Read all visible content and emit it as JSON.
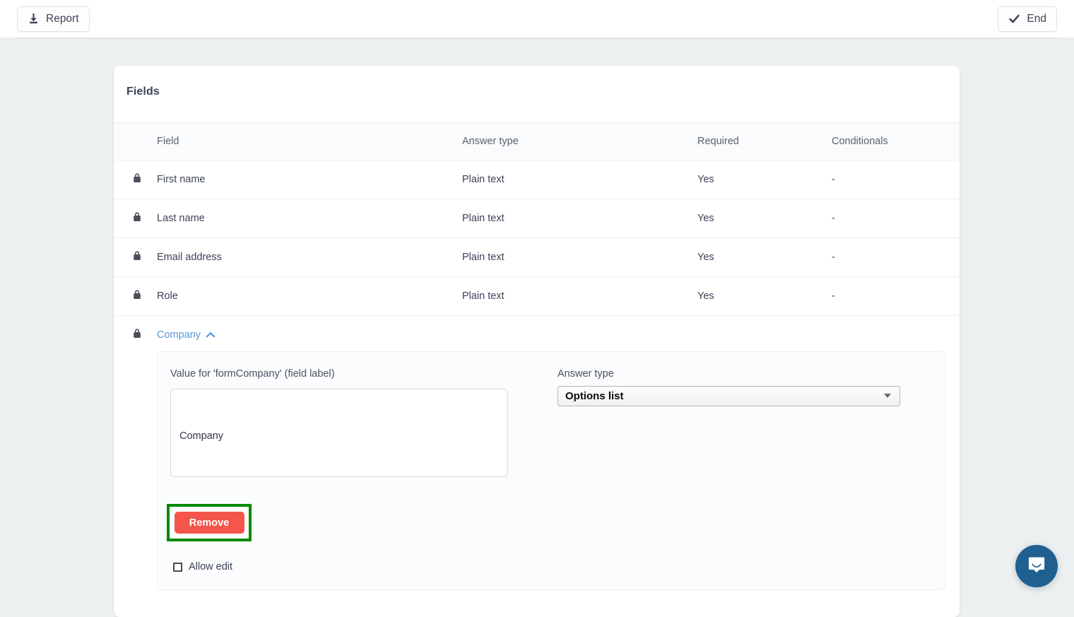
{
  "topbar": {
    "report_label": "Report",
    "report_icon": "download-icon",
    "end_label": "End",
    "end_icon": "check-icon"
  },
  "card": {
    "title": "Fields",
    "table": {
      "columns": [
        "",
        "Field",
        "Answer type",
        "Required",
        "Conditionals"
      ],
      "rows": [
        {
          "lock_icon": "lock-icon",
          "field": "First name",
          "answer_type": "Plain text",
          "required": "Yes",
          "conditionals": "-"
        },
        {
          "lock_icon": "lock-icon",
          "field": "Last name",
          "answer_type": "Plain text",
          "required": "Yes",
          "conditionals": "-"
        },
        {
          "lock_icon": "lock-icon",
          "field": "Email address",
          "answer_type": "Plain text",
          "required": "Yes",
          "conditionals": "-"
        },
        {
          "lock_icon": "lock-icon",
          "field": "Role",
          "answer_type": "Plain text",
          "required": "Yes",
          "conditionals": "-"
        }
      ],
      "expanded_row": {
        "lock_icon": "lock-icon",
        "field": "Company",
        "toggle_icon": "chevron-up-icon",
        "link_color": "#5897d6"
      }
    }
  },
  "panel": {
    "value_label": "Value for 'formCompany' (field label)",
    "value_text": "Company",
    "value_placeholder": "",
    "answer_type_label": "Answer type",
    "answer_type_selected": "Options list",
    "answer_type_options": [
      "Options list"
    ],
    "remove_label": "Remove",
    "remove_color": "#f4564b",
    "highlight_color": "#008a00",
    "allow_edit_label": "Allow edit",
    "allow_edit_checked": false
  },
  "intercom": {
    "icon": "chat-bubble-icon",
    "color": "#1f6091"
  }
}
